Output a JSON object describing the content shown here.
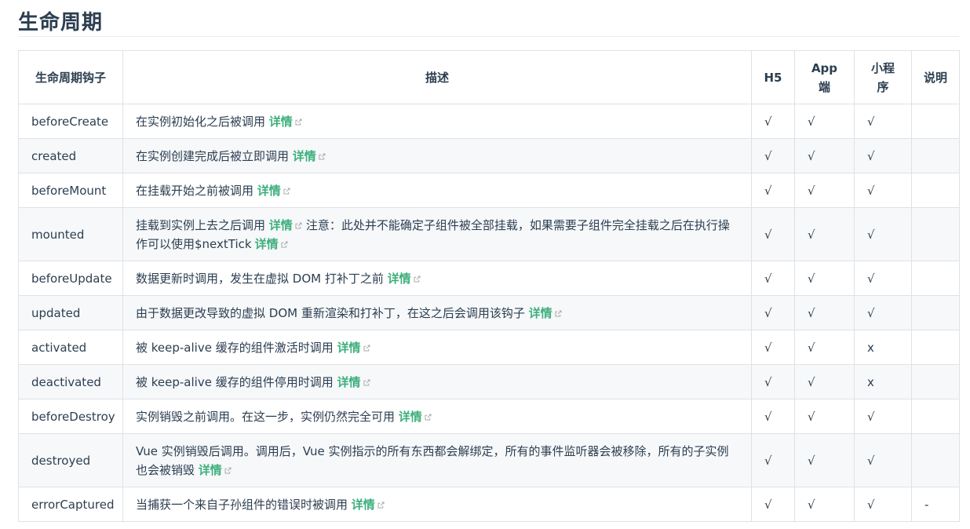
{
  "title": "生命周期",
  "link_label": "详情",
  "headers": [
    "生命周期钩子",
    "描述",
    "H5",
    "App端",
    "小程序",
    "说明"
  ],
  "rows": [
    {
      "hook": "beforeCreate",
      "desc": "在实例初始化之后被调用",
      "extra": "",
      "h5": "√",
      "app": "√",
      "mp": "√",
      "note": ""
    },
    {
      "hook": "created",
      "desc": "在实例创建完成后被立即调用",
      "extra": "",
      "h5": "√",
      "app": "√",
      "mp": "√",
      "note": ""
    },
    {
      "hook": "beforeMount",
      "desc": "在挂载开始之前被调用",
      "extra": "",
      "h5": "√",
      "app": "√",
      "mp": "√",
      "note": ""
    },
    {
      "hook": "mounted",
      "desc": "挂载到实例上去之后调用",
      "extra": "注意：此处并不能确定子组件被全部挂载，如果需要子组件完全挂载之后在执行操作可以使用$nextTick",
      "h5": "√",
      "app": "√",
      "mp": "√",
      "note": ""
    },
    {
      "hook": "beforeUpdate",
      "desc": "数据更新时调用，发生在虚拟 DOM 打补丁之前",
      "extra": "",
      "h5": "√",
      "app": "√",
      "mp": "√",
      "note": ""
    },
    {
      "hook": "updated",
      "desc": "由于数据更改导致的虚拟 DOM 重新渲染和打补丁，在这之后会调用该钩子",
      "extra": "",
      "h5": "√",
      "app": "√",
      "mp": "√",
      "note": ""
    },
    {
      "hook": "activated",
      "desc": "被 keep-alive 缓存的组件激活时调用",
      "extra": "",
      "h5": "√",
      "app": "√",
      "mp": "x",
      "note": ""
    },
    {
      "hook": "deactivated",
      "desc": "被 keep-alive 缓存的组件停用时调用",
      "extra": "",
      "h5": "√",
      "app": "√",
      "mp": "x",
      "note": ""
    },
    {
      "hook": "beforeDestroy",
      "desc": "实例销毁之前调用。在这一步，实例仍然完全可用",
      "extra": "",
      "h5": "√",
      "app": "√",
      "mp": "√",
      "note": ""
    },
    {
      "hook": "destroyed",
      "desc": "Vue 实例销毁后调用。调用后，Vue 实例指示的所有东西都会解绑定，所有的事件监听器会被移除，所有的子实例也会被销毁",
      "extra": "",
      "h5": "√",
      "app": "√",
      "mp": "√",
      "note": ""
    },
    {
      "hook": "errorCaptured",
      "desc": "当捕获一个来自子孙组件的错误时被调用",
      "extra": "",
      "h5": "√",
      "app": "√",
      "mp": "√",
      "note": "-"
    }
  ]
}
